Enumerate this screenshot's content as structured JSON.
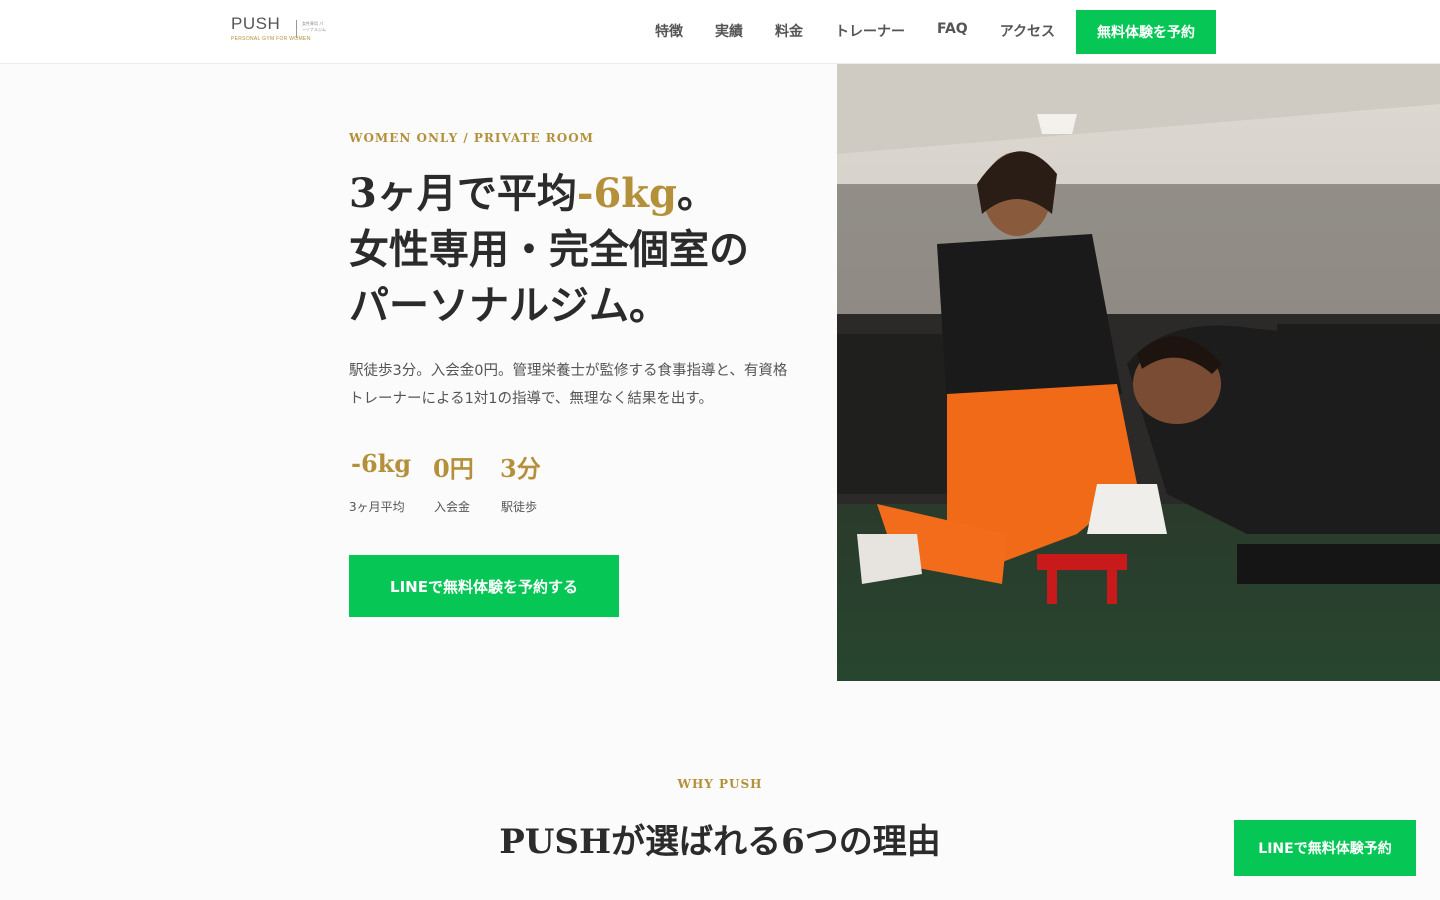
{
  "brand": {
    "name": "PUSH",
    "tagline": "PERSONAL GYM FOR WOMEN",
    "mark_text": "女性専用 パーソナルジム"
  },
  "nav": {
    "items": [
      {
        "label": "特徴"
      },
      {
        "label": "実績"
      },
      {
        "label": "料金"
      },
      {
        "label": "トレーナー"
      },
      {
        "label": "FAQ"
      },
      {
        "label": "アクセス"
      }
    ],
    "cta_label": "無料体験を予約"
  },
  "hero": {
    "eyebrow": "WOMEN ONLY / PRIVATE ROOM",
    "headline_part1": "3ヶ月で平均",
    "headline_accent": "-6kg",
    "headline_part2": "。",
    "headline_line2": "女性専用・完全個室の",
    "headline_line3": "パーソナルジム。",
    "description": "駅徒歩3分。入会金0円。管理栄養士が監修する食事指導と、有資格トレーナーによる1対1の指導で、無理なく結果を出す。",
    "stats": [
      {
        "value": "-6kg",
        "label": "3ヶ月平均"
      },
      {
        "value": "0円",
        "label": "入会金"
      },
      {
        "value": "3分",
        "label": "駅徒歩"
      }
    ],
    "cta_label": "LINEで無料体験を予約する"
  },
  "why": {
    "eyebrow": "WHY PUSH",
    "title": "PUSHが選ばれる6つの理由"
  },
  "floating_cta": {
    "label": "LINEで無料体験予約"
  },
  "colors": {
    "accent_gold": "#b4903b",
    "line_green": "#06c755",
    "text_dark": "#2b2b2b"
  }
}
